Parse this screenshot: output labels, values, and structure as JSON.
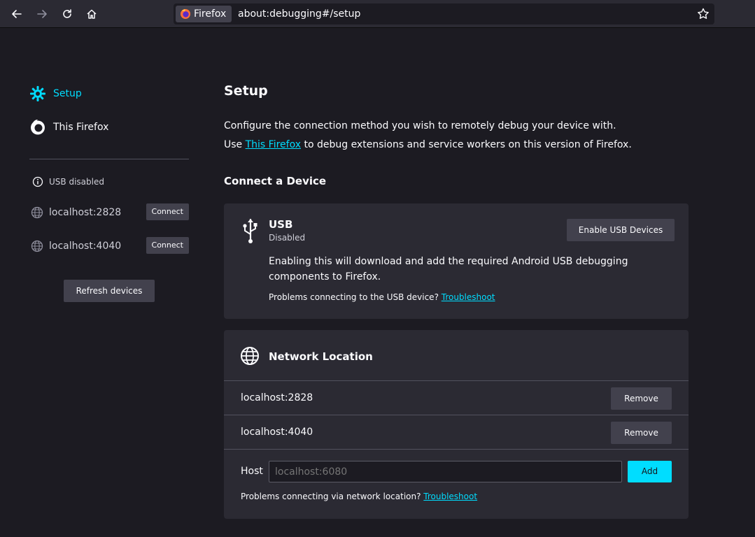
{
  "browser": {
    "identity_label": "Firefox",
    "url": "about:debugging#/setup"
  },
  "sidebar": {
    "setup_label": "Setup",
    "this_firefox_label": "This Firefox",
    "usb_status": "USB disabled",
    "runtimes": [
      {
        "name": "localhost:2828",
        "button": "Connect"
      },
      {
        "name": "localhost:4040",
        "button": "Connect"
      }
    ],
    "refresh_label": "Refresh devices"
  },
  "main": {
    "title": "Setup",
    "intro_line1": "Configure the connection method you wish to remotely debug your device with.",
    "intro_line2_prefix": "Use ",
    "intro_line2_link": "This Firefox",
    "intro_line2_suffix": " to debug extensions and service workers on this version of Firefox.",
    "connect_heading": "Connect a Device",
    "usb": {
      "title": "USB",
      "status": "Disabled",
      "enable_button": "Enable USB Devices",
      "description": "Enabling this will download and add the required Android USB debugging components to Firefox.",
      "problems_text": "Problems connecting to the USB device? ",
      "troubleshoot_link": "Troubleshoot"
    },
    "network": {
      "title": "Network Location",
      "locations": [
        {
          "host": "localhost:2828",
          "button": "Remove"
        },
        {
          "host": "localhost:4040",
          "button": "Remove"
        }
      ],
      "host_label": "Host",
      "host_placeholder": "localhost:6080",
      "add_button": "Add",
      "problems_text": "Problems connecting via network location? ",
      "troubleshoot_link": "Troubleshoot"
    }
  },
  "colors": {
    "accent": "#00ddff",
    "background": "#1c1b22",
    "card": "#2b2a33"
  }
}
